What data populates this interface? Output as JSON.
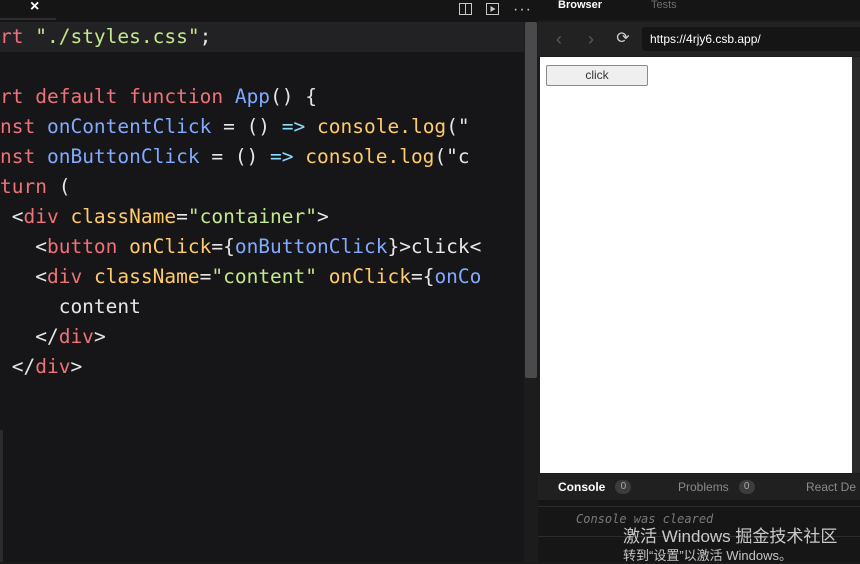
{
  "editor": {
    "close_glyph": "×",
    "actions": {
      "split_icon": "split-view-icon",
      "preview_icon": "preview-icon",
      "more_glyph": "···"
    },
    "lines": [
      [
        {
          "t": "rt ",
          "c": "kw"
        },
        {
          "t": "\"./styles.css\"",
          "c": "str"
        },
        {
          "t": ";",
          "c": "pl"
        }
      ],
      [],
      [
        {
          "t": "rt ",
          "c": "kw"
        },
        {
          "t": "default ",
          "c": "kw"
        },
        {
          "t": "function ",
          "c": "kw"
        },
        {
          "t": "App",
          "c": "fn"
        },
        {
          "t": "() {",
          "c": "pl"
        }
      ],
      [
        {
          "t": "nst ",
          "c": "kw"
        },
        {
          "t": "onContentClick",
          "c": "fnv"
        },
        {
          "t": " = () ",
          "c": "pl"
        },
        {
          "t": "=>",
          "c": "op"
        },
        {
          "t": " console.",
          "c": "call"
        },
        {
          "t": "log",
          "c": "call"
        },
        {
          "t": "(\"",
          "c": "pl"
        }
      ],
      [
        {
          "t": "nst ",
          "c": "kw"
        },
        {
          "t": "onButtonClick",
          "c": "fnv"
        },
        {
          "t": " = () ",
          "c": "pl"
        },
        {
          "t": "=>",
          "c": "op"
        },
        {
          "t": " console.",
          "c": "call"
        },
        {
          "t": "log",
          "c": "call"
        },
        {
          "t": "(\"c",
          "c": "pl"
        }
      ],
      [
        {
          "t": "turn ",
          "c": "kw"
        },
        {
          "t": "(",
          "c": "pl"
        }
      ],
      [
        {
          "t": " <",
          "c": "pl"
        },
        {
          "t": "div ",
          "c": "tag"
        },
        {
          "t": "className",
          "c": "attr"
        },
        {
          "t": "=",
          "c": "pl"
        },
        {
          "t": "\"container\"",
          "c": "str"
        },
        {
          "t": ">",
          "c": "pl"
        }
      ],
      [
        {
          "t": "   <",
          "c": "pl"
        },
        {
          "t": "button ",
          "c": "tag"
        },
        {
          "t": "onClick",
          "c": "attr"
        },
        {
          "t": "={",
          "c": "pl"
        },
        {
          "t": "onButtonClick",
          "c": "fnv"
        },
        {
          "t": "}>click<",
          "c": "pl"
        }
      ],
      [
        {
          "t": "   <",
          "c": "pl"
        },
        {
          "t": "div ",
          "c": "tag"
        },
        {
          "t": "className",
          "c": "attr"
        },
        {
          "t": "=",
          "c": "pl"
        },
        {
          "t": "\"content\" ",
          "c": "str"
        },
        {
          "t": "onClick",
          "c": "attr"
        },
        {
          "t": "={",
          "c": "pl"
        },
        {
          "t": "onCo",
          "c": "fnv"
        }
      ],
      [
        {
          "t": "     content",
          "c": "pl"
        }
      ],
      [
        {
          "t": "   </",
          "c": "pl"
        },
        {
          "t": "div",
          "c": "tag"
        },
        {
          "t": ">",
          "c": "pl"
        }
      ],
      [
        {
          "t": " </",
          "c": "pl"
        },
        {
          "t": "div",
          "c": "tag"
        },
        {
          "t": ">",
          "c": "pl"
        }
      ]
    ]
  },
  "preview": {
    "tabs": {
      "browser": "Browser",
      "tests": "Tests"
    },
    "nav": {
      "back_glyph": "‹",
      "forward_glyph": "›",
      "reload_glyph": "⟳"
    },
    "url": "https://4rjy6.csb.app/",
    "page_button_label": "click",
    "devtools": {
      "console": {
        "label": "Console",
        "count": "0"
      },
      "problems": {
        "label": "Problems",
        "count": "0"
      },
      "react": {
        "label": "React De"
      }
    },
    "console_message": "Console was cleared"
  },
  "watermark": {
    "line1": "激活 Windows 掘金技术社区",
    "line2": "转到“设置”以激活 Windows。"
  }
}
